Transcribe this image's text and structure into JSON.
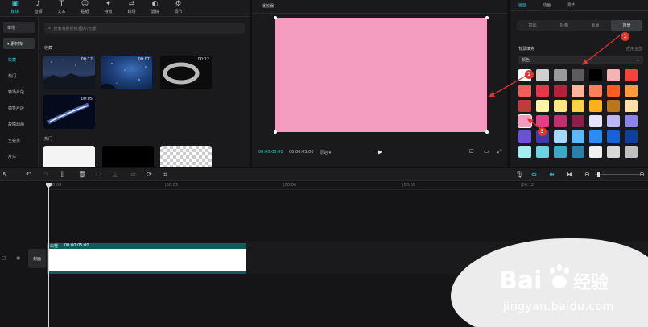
{
  "toolbar": {
    "items": [
      {
        "label": "媒体",
        "icon": "media-icon"
      },
      {
        "label": "音频",
        "icon": "audio-icon"
      },
      {
        "label": "文本",
        "icon": "text-icon"
      },
      {
        "label": "贴纸",
        "icon": "sticker-icon"
      },
      {
        "label": "特效",
        "icon": "effects-icon"
      },
      {
        "label": "转场",
        "icon": "transition-icon"
      },
      {
        "label": "滤镜",
        "icon": "filter-icon"
      },
      {
        "label": "调节",
        "icon": "adjust-icon"
      }
    ]
  },
  "sidebar": {
    "local_label": "本地",
    "library_label": "▾ 素材库",
    "items": [
      "收藏",
      "热门",
      "转场片段",
      "搞笑片段",
      "故障动画",
      "空镜头",
      "片头"
    ]
  },
  "media": {
    "search_placeholder": "搜索海量视频/图片/元素",
    "section_favorites": "收藏",
    "section_hot": "热门",
    "favorites": [
      {
        "duration": "00:12"
      },
      {
        "duration": "00:07"
      },
      {
        "duration": "00:12"
      },
      {
        "duration": "00:05"
      }
    ]
  },
  "player": {
    "title": "播放器",
    "current_time": "00:00:00:00",
    "total_time": "00:00:05:00",
    "ratio_label": "原始 ▾",
    "canvas_color": "#f49bc0"
  },
  "props": {
    "tabs": [
      "画面",
      "动画",
      "调节"
    ],
    "sub_tabs": [
      "基础",
      "抠像",
      "蒙版",
      "背景"
    ],
    "section_title": "背景填充",
    "apply_all": "应用全部",
    "select_value": "颜色",
    "swatches": [
      [
        "#ffffff",
        "#cfcfcf",
        "#9a9a9a",
        "#5c5c5c",
        "#000000",
        "#f7b3b3",
        "#f5423e"
      ],
      [
        "#f25c5c",
        "#e83549",
        "#b81f3a",
        "#ffb59a",
        "#ff7e5a",
        "#ff5b1d",
        "#ff9b3a"
      ],
      [
        "#c23a3a",
        "#fff4a8",
        "#ffe680",
        "#ffd24a",
        "#ffb11a",
        "#b8761e",
        "#fce0a8"
      ],
      [
        "#f49bc0",
        "#e43f86",
        "#c0316d",
        "#8e1e4b",
        "#e7e3ff",
        "#bbb6f5",
        "#8c82e8"
      ],
      [
        "#6a52d6",
        "#3e3da8",
        "#a5d8ff",
        "#5cb8ff",
        "#2d8cf0",
        "#1663d6",
        "#0e3f9c"
      ],
      [
        "#a3ecf0",
        "#6ed3e0",
        "#3aa9c6",
        "#2d7fa8",
        "#f0f0f0",
        "#d8d8d8",
        "#c0c0c0"
      ]
    ],
    "selected_swatch": "#f49bc0"
  },
  "annotations": {
    "badge_1": "1",
    "badge_2": "2",
    "badge_3": "3"
  },
  "timeline": {
    "ruler_labels": [
      "00:00",
      "|00:03",
      "|00:06",
      "|00:09",
      "|00:12"
    ],
    "cover_label": "封面",
    "clip_label": "白橙",
    "clip_duration": "00:00:05:00"
  },
  "watermark": {
    "url": "jingyan.baidu.com"
  }
}
